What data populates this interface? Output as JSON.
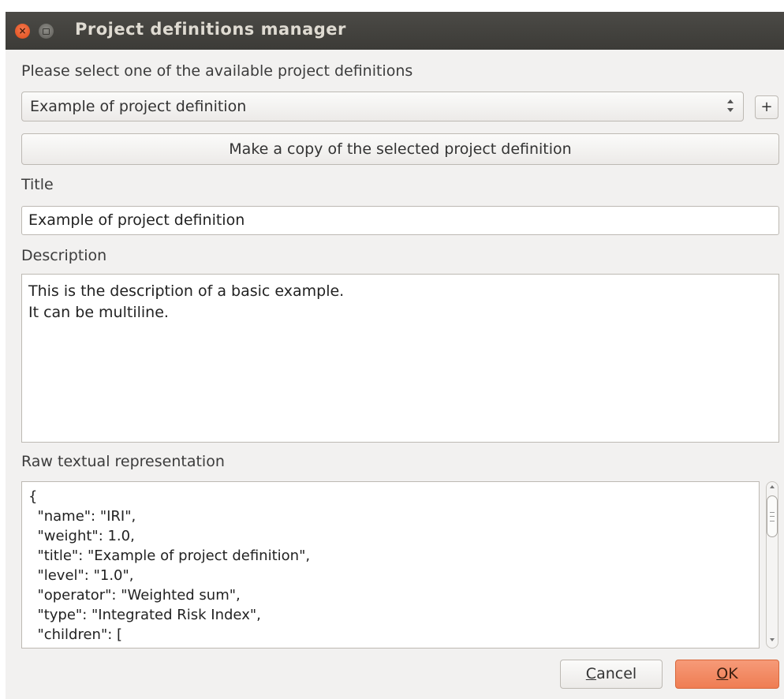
{
  "window": {
    "title": "Project definitions manager",
    "close_icon": "close-icon",
    "minimize_icon": "minimize-icon",
    "accent_close": "#df4a16",
    "accent_ok": "#ef7d53"
  },
  "select_label": "Please select one of the available project definitions",
  "project_combo": {
    "value": "Example of project definition"
  },
  "add_button": {
    "label": "+"
  },
  "copy_button": {
    "label": "Make a copy of the selected project definition"
  },
  "title_field": {
    "label": "Title",
    "value": "Example of project definition"
  },
  "description_field": {
    "label": "Description",
    "lines": [
      "This is the description of a basic example.",
      "It can be multiline."
    ]
  },
  "raw_field": {
    "label": "Raw textual representation",
    "lines": [
      "{",
      "  \"name\": \"IRI\",",
      "  \"weight\": 1.0,",
      "  \"title\": \"Example of project definition\",",
      "  \"level\": \"1.0\",",
      "  \"operator\": \"Weighted sum\",",
      "  \"type\": \"Integrated Risk Index\",",
      "  \"children\": ["
    ]
  },
  "buttons": {
    "cancel_mnemonic": "C",
    "cancel_rest": "ancel",
    "ok_mnemonic": "O",
    "ok_rest": "K"
  }
}
